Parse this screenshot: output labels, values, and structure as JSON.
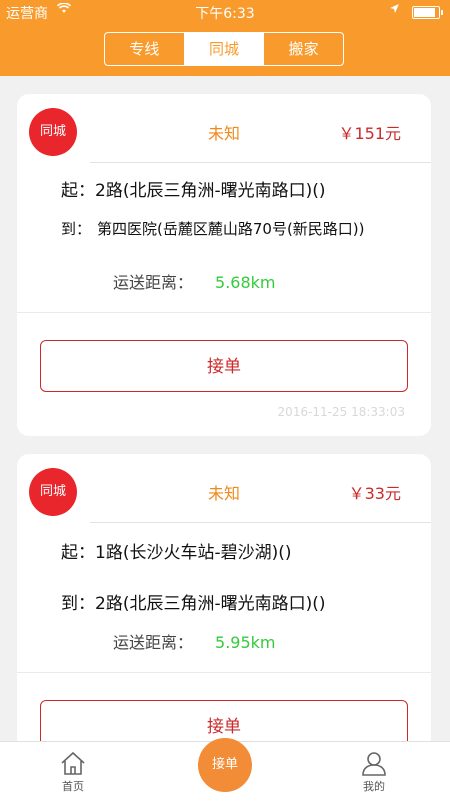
{
  "status_bar": {
    "carrier": "运营商",
    "time": "下午6:33",
    "battery_fill": 0.95
  },
  "header": {
    "tabs": [
      {
        "label": "专线"
      },
      {
        "label": "同城"
      },
      {
        "label": "搬家"
      }
    ],
    "active_tab": "同城"
  },
  "orders": [
    {
      "badge": "同城",
      "status": "未知",
      "price": "￥151元",
      "from_label": "起：",
      "from": "2路(北辰三角洲-曙光南路口)()",
      "to_label": "到：",
      "to": "第四医院(岳麓区麓山路70号(新民路口))",
      "distance_label": "运送距离：",
      "distance": "5.68km",
      "action": "接单",
      "timestamp": "2016-11-25 18:33:03"
    },
    {
      "badge": "同城",
      "status": "未知",
      "price": "￥33元",
      "from_label": "起：",
      "from": "1路(长沙火车站-碧沙湖)()",
      "to_label": "到：",
      "to": "2路(北辰三角洲-曙光南路口)()",
      "distance_label": "运送距离：",
      "distance": "5.95km",
      "action": "接单",
      "timestamp": ""
    }
  ],
  "tabbar": {
    "items": [
      {
        "label": "首页",
        "icon": "home-icon"
      },
      {
        "label": "我的",
        "icon": "user-icon"
      }
    ],
    "center_button": "接单"
  },
  "colors": {
    "header": "#f99b2c",
    "badge": "#e8262c",
    "price": "#cc2a2a",
    "status": "#f0891c",
    "distance": "#35cb3c"
  }
}
